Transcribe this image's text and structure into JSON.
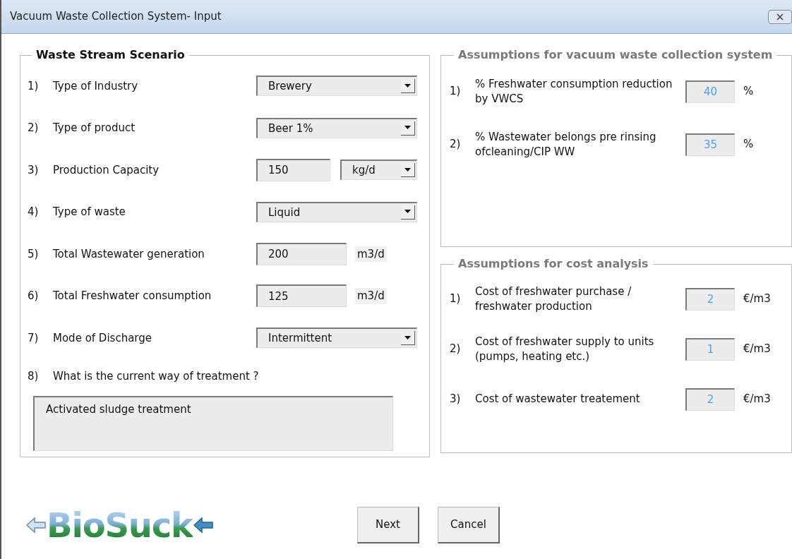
{
  "window": {
    "title": "Vacuum Waste Collection System- Input"
  },
  "waste_stream": {
    "title": "Waste Stream Scenario",
    "rows": [
      {
        "number": "1)",
        "label": "Type of Industry",
        "kind": "dropdown",
        "value": "Brewery"
      },
      {
        "number": "2)",
        "label": "Type of product",
        "kind": "dropdown",
        "value": "Beer 1%"
      },
      {
        "number": "3)",
        "label": "Production Capacity",
        "kind": "field_dropdown",
        "value": "150",
        "unit": "kg/d"
      },
      {
        "number": "4)",
        "label": "Type of waste",
        "kind": "dropdown",
        "value": "Liquid"
      },
      {
        "number": "5)",
        "label": "Total Wastewater generation",
        "kind": "field_unit",
        "value": "200",
        "unit": "m3/d"
      },
      {
        "number": "6)",
        "label": "Total Freshwater consumption",
        "kind": "field_unit",
        "value": "125",
        "unit": "m3/d"
      },
      {
        "number": "7)",
        "label": "Mode of Discharge",
        "kind": "dropdown",
        "value": "Intermittent"
      }
    ],
    "treatment": {
      "number": "8)",
      "label": "What is the current way of treatment ?",
      "value": "Activated sludge treatment"
    }
  },
  "vwcs_assumptions": {
    "title": "Assumptions for vacuum waste collection system",
    "rows": [
      {
        "number": "1)",
        "label": "% Freshwater consumption reduction by VWCS",
        "value": "40",
        "unit": "%"
      },
      {
        "number": "2)",
        "label": "% Wastewater belongs pre rinsing ofcleaning/CIP WW",
        "value": "35",
        "unit": "%"
      }
    ]
  },
  "cost_assumptions": {
    "title": "Assumptions for cost analysis",
    "rows": [
      {
        "number": "1)",
        "label": "Cost of freshwater purchase / freshwater production",
        "value": "2",
        "unit": "€/m3"
      },
      {
        "number": "2)",
        "label": "Cost of freshwater supply to units (pumps, heating etc.)",
        "value": "1",
        "unit": "€/m3"
      },
      {
        "number": "3)",
        "label": "Cost of wastewater treatement",
        "value": "2",
        "unit": "€/m3"
      }
    ]
  },
  "logo": {
    "text": "BioSuck"
  },
  "buttons": [
    "Next",
    "Cancel"
  ]
}
